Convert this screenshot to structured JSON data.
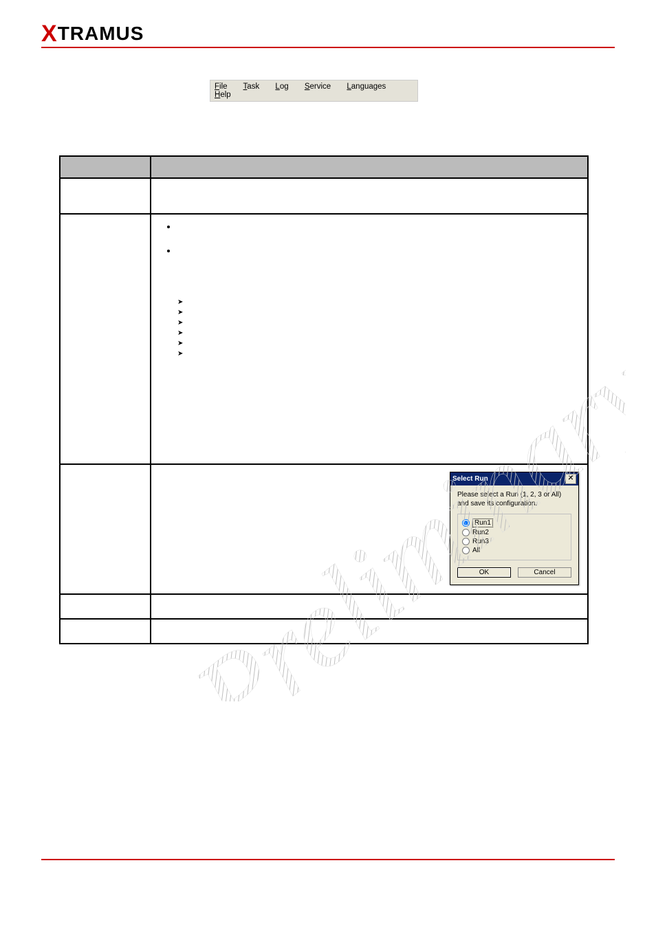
{
  "logo": {
    "x": "X",
    "rest": "TRAMUS"
  },
  "watermark": "Preliminary",
  "menubar": {
    "items": [
      {
        "mnemonic": "F",
        "rest": "ile"
      },
      {
        "mnemonic": "T",
        "rest": "ask"
      },
      {
        "mnemonic": "L",
        "rest": "og"
      },
      {
        "mnemonic": "S",
        "rest": "ervice"
      },
      {
        "mnemonic": "L",
        "rest": "anguages"
      },
      {
        "mnemonic": "H",
        "rest": "elp"
      }
    ]
  },
  "table": {
    "header1": "",
    "header2": "",
    "rows": {
      "r1c1": "",
      "r1c2": "",
      "r2c1": "",
      "bullets": [
        "",
        ""
      ],
      "arrows": [
        "",
        "",
        "",
        "",
        "",
        ""
      ],
      "r3c1": "",
      "r4c1": "",
      "r4c2": "",
      "r5c1": "",
      "r5c2": ""
    }
  },
  "select_run": {
    "title": "Select Run",
    "close": "✕",
    "msg": "Please select a Run (1, 2, 3 or All) and save its configuration.",
    "opt1": "Run1",
    "opt2": "Run2",
    "opt3": "Run3",
    "opt4": "All",
    "ok": "OK",
    "cancel": "Cancel"
  },
  "footer": {
    "left": "",
    "center": "",
    "right": ""
  }
}
